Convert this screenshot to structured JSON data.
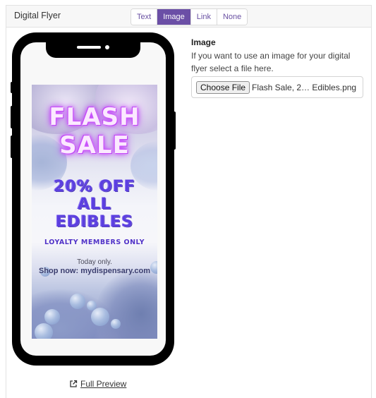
{
  "panel": {
    "title": "Digital Flyer",
    "tabs": [
      {
        "label": "Text",
        "active": false
      },
      {
        "label": "Image",
        "active": true
      },
      {
        "label": "Link",
        "active": false
      },
      {
        "label": "None",
        "active": false
      }
    ]
  },
  "flyer": {
    "line1": "FLASH",
    "line2": "SALE",
    "line3": "20% OFF",
    "line4": "ALL",
    "line5": "EDIBLES",
    "tagline": "LOYALTY MEMBERS ONLY",
    "note": "Today only.",
    "cta": "Shop now: mydispensary.com"
  },
  "preview": {
    "label": "Full Preview",
    "icon": "external-link-icon"
  },
  "image_field": {
    "label": "Image",
    "help": "If you want to use an image for your digital flyer select a file here.",
    "button_label": "Choose File",
    "file_name": "Flash Sale, 2… Edibles.png"
  },
  "colors": {
    "accent": "#6b4fa6",
    "neon": "#c040ff",
    "flyer_text": "#5b3fe0"
  }
}
